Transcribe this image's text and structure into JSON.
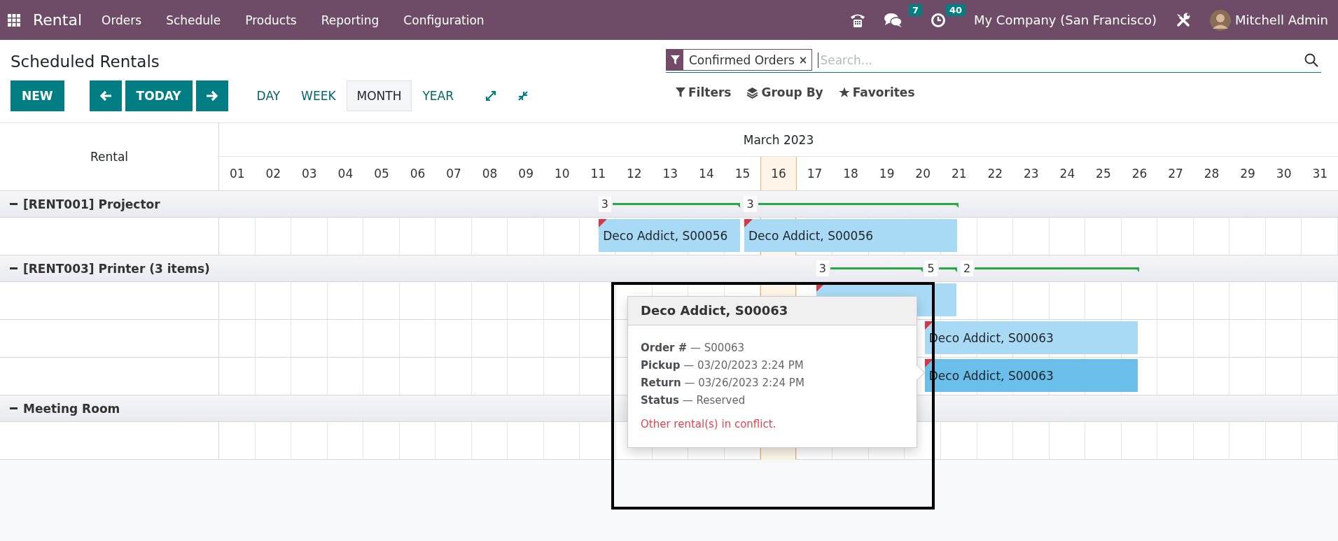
{
  "navbar": {
    "app_name": "Rental",
    "menu": [
      "Orders",
      "Schedule",
      "Products",
      "Reporting",
      "Configuration"
    ],
    "messages_badge": "7",
    "activities_badge": "40",
    "company": "My Company (San Francisco)",
    "user": "Mitchell Admin"
  },
  "title": "Scheduled Rentals",
  "buttons": {
    "new": "NEW",
    "today": "TODAY"
  },
  "scales": [
    {
      "label": "DAY",
      "selected": false
    },
    {
      "label": "WEEK",
      "selected": false
    },
    {
      "label": "MONTH",
      "selected": true
    },
    {
      "label": "YEAR",
      "selected": false
    }
  ],
  "search": {
    "facet": "Confirmed Orders",
    "facet_remove": "×",
    "placeholder": "Search..."
  },
  "search_menus": [
    {
      "kind": "filter",
      "label": "Filters"
    },
    {
      "kind": "group",
      "label": "Group By"
    },
    {
      "kind": "favorite",
      "label": "Favorites"
    }
  ],
  "gantt": {
    "row_header": "Rental",
    "month": "March 2023",
    "days": [
      {
        "label": "01",
        "today": false
      },
      {
        "label": "02",
        "today": false
      },
      {
        "label": "03",
        "today": false
      },
      {
        "label": "04",
        "today": false
      },
      {
        "label": "05",
        "today": false
      },
      {
        "label": "06",
        "today": false
      },
      {
        "label": "07",
        "today": false
      },
      {
        "label": "08",
        "today": false
      },
      {
        "label": "09",
        "today": false
      },
      {
        "label": "10",
        "today": false
      },
      {
        "label": "11",
        "today": false
      },
      {
        "label": "12",
        "today": false
      },
      {
        "label": "13",
        "today": false
      },
      {
        "label": "14",
        "today": false
      },
      {
        "label": "15",
        "today": false
      },
      {
        "label": "16",
        "today": true
      },
      {
        "label": "17",
        "today": false
      },
      {
        "label": "18",
        "today": false
      },
      {
        "label": "19",
        "today": false
      },
      {
        "label": "20",
        "today": false
      },
      {
        "label": "21",
        "today": false
      },
      {
        "label": "22",
        "today": false
      },
      {
        "label": "23",
        "today": false
      },
      {
        "label": "24",
        "today": false
      },
      {
        "label": "25",
        "today": false
      },
      {
        "label": "26",
        "today": false
      },
      {
        "label": "27",
        "today": false
      },
      {
        "label": "28",
        "today": false
      },
      {
        "label": "29",
        "today": false
      },
      {
        "label": "30",
        "today": false
      },
      {
        "label": "31",
        "today": false
      }
    ],
    "groups": [
      {
        "title": "[RENT001] Projector",
        "expanded": true,
        "availability": [
          "3",
          "3"
        ],
        "rows": [
          [
            {
              "label": "Deco Addict, S00056",
              "conflict": true,
              "highlighted": false
            },
            {
              "label": "Deco Addict, S00056",
              "conflict": true,
              "highlighted": false
            }
          ]
        ]
      },
      {
        "title": "[RENT003] Printer (3 items)",
        "expanded": true,
        "availability": [
          "3",
          "5",
          "2"
        ],
        "rows": [
          [
            {
              "conflict": true,
              "highlighted": false
            }
          ],
          [
            {
              "label": "Deco Addict, S00063",
              "conflict": true,
              "highlighted": false
            }
          ],
          [
            {
              "label": "Deco Addict, S00063",
              "conflict": true,
              "highlighted": true
            }
          ]
        ]
      },
      {
        "title": "Meeting Room",
        "expanded": true,
        "rows": [
          []
        ]
      }
    ]
  },
  "popover": {
    "title": "Deco Addict, S00063",
    "lines": [
      "**Order #** — S00063",
      "**Pickup** — 03/20/2023 2:24 PM",
      "**Return** — 03/26/2023 2:24 PM",
      "**Status** — Reserved"
    ],
    "warning": "Other rental(s) in conflict."
  }
}
